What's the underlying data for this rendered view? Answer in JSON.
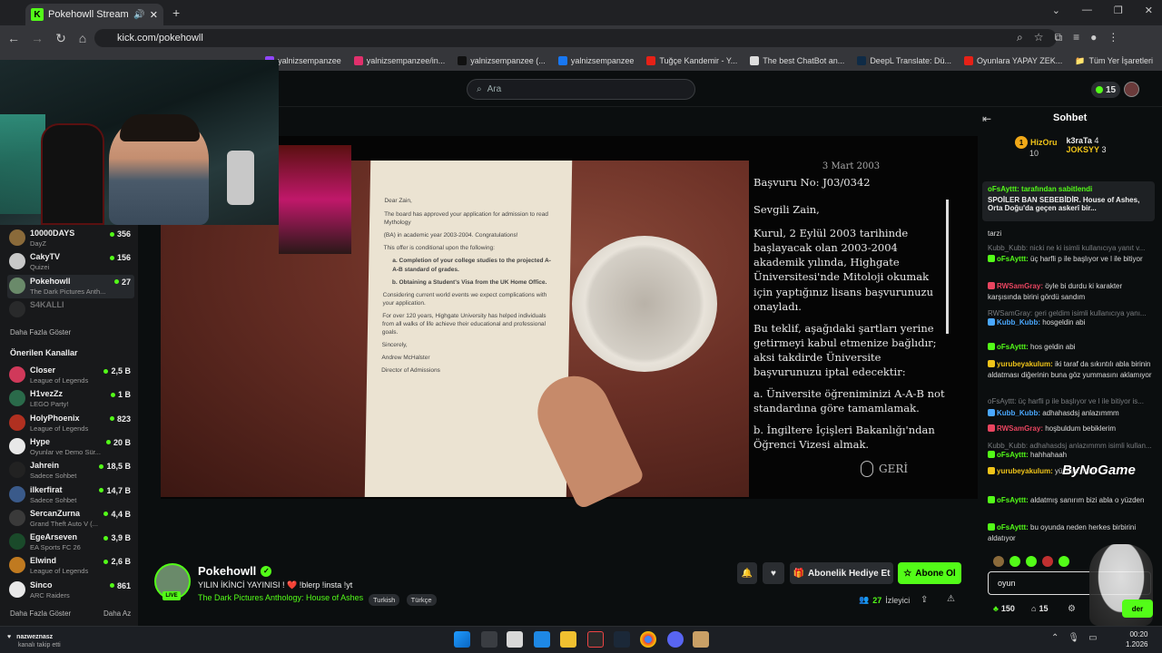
{
  "browser": {
    "tab_title": "Pokehowll Stream - Watch l",
    "url": "kick.com/pokehowll",
    "bookmarks": [
      "yalnizsempanzee",
      "yalnizsempanzee/in...",
      "yalnizsempanzee (...",
      "yalnizsempanzee",
      "Tuğçe Kandemir - Y...",
      "The best ChatBot an...",
      "DeepL Translate: Dü...",
      "Oyunlara YAPAY ZEK..."
    ],
    "all_bookmarks": "Tüm Yer İşaretleri"
  },
  "header": {
    "search_placeholder": "Ara",
    "notif_count": "15"
  },
  "sidebar": {
    "followed": [
      {
        "name": "10000DAYS",
        "game": "DayZ",
        "viewers": "356",
        "color": "#8a6a3a"
      },
      {
        "name": "CakyTV",
        "game": "Quizei",
        "viewers": "156",
        "color": "#c8c8c8"
      },
      {
        "name": "Pokehowll",
        "game": "The Dark Pictures Anth...",
        "viewers": "27",
        "color": "#6a8a6a"
      },
      {
        "name": "S4KALLI",
        "game": "",
        "viewers": "",
        "color": "#444444"
      }
    ],
    "show_more": "Daha Fazla Göster",
    "recommended_title": "Önerilen Kanallar",
    "recommended": [
      {
        "name": "Closer",
        "game": "League of Legends",
        "viewers": "2,5 B",
        "color": "#d0395a"
      },
      {
        "name": "H1vezZz",
        "game": "LEGO Party!",
        "viewers": "1 B",
        "color": "#2a6a4a"
      },
      {
        "name": "HolyPhoenix",
        "game": "League of Legends",
        "viewers": "823",
        "color": "#b03020"
      },
      {
        "name": "Hype",
        "game": "Oyunlar ve Demo Sür...",
        "viewers": "20 B",
        "color": "#e8e8e8"
      },
      {
        "name": "Jahrein",
        "game": "Sadece Sohbet",
        "viewers": "18,5 B",
        "color": "#222222"
      },
      {
        "name": "ilkerfirat",
        "game": "Sadece Sohbet",
        "viewers": "14,7 B",
        "color": "#3a5a8a"
      },
      {
        "name": "SercanZurna",
        "game": "Grand Theft Auto V (...",
        "viewers": "4,4 B",
        "color": "#3a3a3a"
      },
      {
        "name": "EgeArseven",
        "game": "EA Sports FC 26",
        "viewers": "3,9 B",
        "color": "#1a4a2a"
      },
      {
        "name": "Elwind",
        "game": "League of Legends",
        "viewers": "2,6 B",
        "color": "#c07a20"
      },
      {
        "name": "Sinco",
        "game": "ARC Raiders",
        "viewers": "861",
        "color": "#e8e8e8"
      }
    ],
    "footer_more": "Daha Fazla Göster",
    "footer_less": "Daha Az"
  },
  "video": {
    "letter_lines": [
      "The board has approved your application for admission to read Mythology",
      "(BA) in academic year 2003-2004. Congratulations!",
      "This offer is conditional upon the following:",
      "a. Completion of your college studies to the projected A-A-B standard of grades.",
      "b. Obtaining a Student's Visa from the UK Home Office.",
      "Considering current world events we expect complications with your application.",
      "For over 120 years, Highgate University has helped individuals from all walks of life achieve their educational and professional goals.",
      "Sincerely,",
      "Andrew McHalster",
      "Director of Admissions"
    ],
    "letter_salutation": "Dear Zain,",
    "subs_date": "3 Mart 2003",
    "subs_ref": "Başvuru No: J03/0342",
    "subs_greet": "Sevgili Zain,",
    "subs_p1": "Kurul, 2 Eylül 2003 tarihinde başlayacak olan 2003-2004 akademik yılında, Highgate Üniversitesi'nde Mitoloji okumak için yaptığınız lisans başvurunuzu onayladı.",
    "subs_p2": "Bu teklif, aşağıdaki şartları yerine getirmeyi kabul etmenize bağlıdır; aksi takdirde Üniversite başvurunuzu iptal edecektir:",
    "subs_a": "a. Üniversite öğreniminizi A-A-B not standardına göre tamamlamak.",
    "subs_b": "b. İngiltere İçişleri Bakanlığı'ndan Öğrenci Vizesi almak.",
    "back_label": "GERİ"
  },
  "stream": {
    "name": "Pokehowll",
    "title": "YILIN İKİNCİ YAYINISI ! ❤️ !blerp !insta !yt",
    "game": "The Dark Pictures Anthology: House of Ashes",
    "tags": [
      "Turkish",
      "Türkçe"
    ],
    "live": "LIVE",
    "viewers": "27",
    "viewers_label": "İzleyici",
    "gift_label": "Abonelik Hediye Et",
    "sub_label": "Abone Ol"
  },
  "chat": {
    "title": "Sohbet",
    "leaderboard": [
      {
        "name": "HizOru",
        "value": "10"
      },
      {
        "name": "k3raTa",
        "value": "4"
      },
      {
        "name": "JOKSYY",
        "value": "3"
      }
    ],
    "pinned_by": "oFsAyttt: tarafından sabitlendi",
    "pinned_text": "SPOİLER BAN SEBEBİDİR. House of Ashes, Orta Doğu'da geçen askerî bir...",
    "messages": [
      {
        "user": "",
        "text": "tarzi",
        "cls": ""
      },
      {
        "user": "Kubb_Kubb:",
        "text": "nicki ne ki isimli kullanıcıya yanıt v...",
        "cls": "g"
      },
      {
        "user": "oFsAyttt:",
        "text": "üç harfli p ile başlıyor ve l ile bitiyor",
        "cls": "u"
      },
      {
        "user": "RWSamGray:",
        "text": "öyle bi durdu ki karakter karşısında birini gördü sandım",
        "cls": "r"
      },
      {
        "user": "RWSamGray:",
        "text": "geri geldim isimli kullanıcıya yanı...",
        "cls": "g"
      },
      {
        "user": "Kubb_Kubb:",
        "text": "hosgeldin abi",
        "cls": "b"
      },
      {
        "user": "oFsAyttt:",
        "text": "hos geldin abi",
        "cls": "u"
      },
      {
        "user": "yurubeyakulum:",
        "text": "iki taraf da sıkıntılı abla birinin aldatması diğerinin buna göz yummasını aklamıyor",
        "cls": "y"
      },
      {
        "user": "oFsAyttt:",
        "text": "üç harfli p ile başlıyor ve l ile bitiyor is...",
        "cls": "g"
      },
      {
        "user": "Kubb_Kubb:",
        "text": "adhahasdsj anlazımmm",
        "cls": "b"
      },
      {
        "user": "RWSamGray:",
        "text": "hoşbuldum bebiklerim",
        "cls": "r"
      },
      {
        "user": "Kubb_Kubb:",
        "text": "adhahasdsj anlazımmm isimli kullan...",
        "cls": "g"
      },
      {
        "user": "oFsAyttt:",
        "text": "hahhahaah",
        "cls": "u"
      },
      {
        "user": "yurubeyakulum:",
        "text": "yüzden ıraklı",
        "cls": "y"
      },
      {
        "user": "oFsAyttt:",
        "text": "aldatmış sanırım bizi abla o yüzden",
        "cls": "u"
      },
      {
        "user": "oFsAyttt:",
        "text": "bu oyunda neden herkes birbirini aldatıyor",
        "cls": "u"
      }
    ],
    "watermark": "ByNoGame",
    "input_value": "oyun",
    "points": "150",
    "store_count": "15",
    "send_label": "der"
  },
  "taskbar": {
    "time": "00:20",
    "date": "1.2026",
    "notif_user": "nazweznasz",
    "notif_text": "kanalı takip etti"
  }
}
